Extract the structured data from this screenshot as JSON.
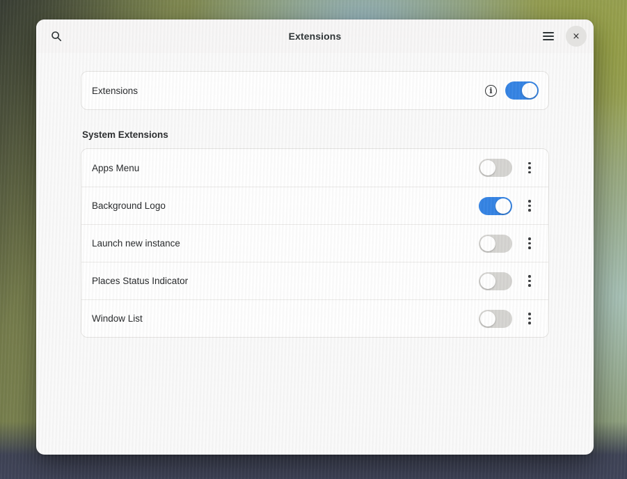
{
  "window": {
    "title": "Extensions",
    "header": {
      "search_icon": "search-icon",
      "menu_icon": "hamburger-menu-icon",
      "close_label": "×"
    }
  },
  "master": {
    "label": "Extensions",
    "info_icon_glyph": "i",
    "enabled": true
  },
  "sections": [
    {
      "title": "System Extensions",
      "items": [
        {
          "label": "Apps Menu",
          "enabled": false
        },
        {
          "label": "Background Logo",
          "enabled": true
        },
        {
          "label": "Launch new instance",
          "enabled": false
        },
        {
          "label": "Places Status Indicator",
          "enabled": false
        },
        {
          "label": "Window List",
          "enabled": false
        }
      ]
    }
  ],
  "colors": {
    "accent": "#3584e4",
    "toggle_off": "#d6d5d2",
    "headerbar": "#f8f7f7",
    "window_bg": "#fafafa",
    "card_bg": "#ffffff"
  }
}
